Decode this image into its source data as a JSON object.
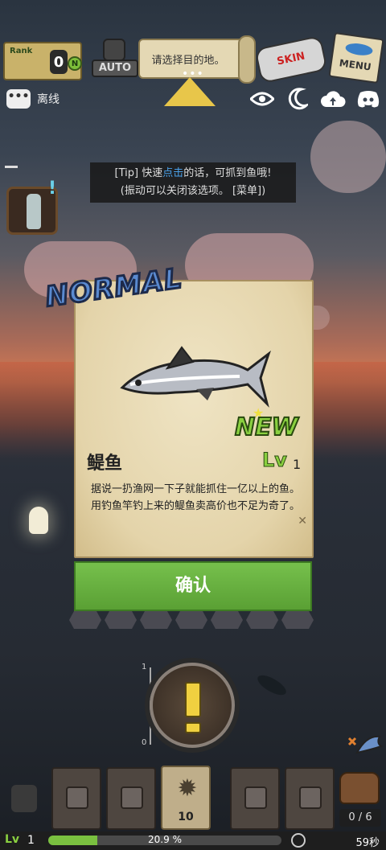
{
  "top": {
    "rank_label": "Rank",
    "rank_value": "0",
    "rank_badge": "N",
    "auto_label": "AUTO",
    "destination_text": "请选择目的地。",
    "skin_label": "SKIN",
    "menu_label": "MENU",
    "triangle_dots": "•••"
  },
  "status": {
    "chat_icon": "•••",
    "chat_status": "离线",
    "icons": [
      "eye-icon",
      "moon-icon",
      "cloud-upload-icon",
      "discord-icon"
    ]
  },
  "tip": {
    "line1_prefix": "[Tip] 快速",
    "line1_highlight": "点击",
    "line1_suffix": "的话，可抓到鱼哦!",
    "line2": "(振动可以关闭该选项。 [菜单])"
  },
  "catch": {
    "rarity": "NORMAL",
    "new_label": "NEW",
    "fish_name": "鳀鱼",
    "level_prefix": "Lv",
    "level": "1",
    "description_line1": "据说一扔渔网一下子就能抓住一亿以上的鱼。",
    "description_line2": "用钓鱼竿钓上来的鳀鱼卖高价也不足为奇了。",
    "confirm_label": "确认"
  },
  "gauge": {
    "top_label": "1",
    "bottom_label": "0"
  },
  "inventory": {
    "active_count": "10",
    "bag_count": "0 / 6"
  },
  "footer": {
    "level_icon": "Lv",
    "level": "1",
    "xp_percent_text": "20.9 %",
    "xp_fraction": 0.209,
    "timer": "59秒"
  },
  "colors": {
    "accent_green": "#76c04c",
    "card_paper": "#e4d4aa",
    "rarity_blue": "#5a8ad0",
    "alert_yellow": "#f0d040"
  }
}
